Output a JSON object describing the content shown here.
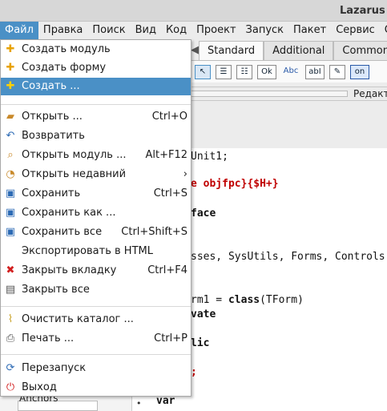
{
  "window": {
    "title": "Lazarus ID"
  },
  "menubar": [
    {
      "label": "Файл",
      "active": true
    },
    {
      "label": "Правка"
    },
    {
      "label": "Поиск"
    },
    {
      "label": "Вид"
    },
    {
      "label": "Код"
    },
    {
      "label": "Проект"
    },
    {
      "label": "Запуск"
    },
    {
      "label": "Пакет"
    },
    {
      "label": "Сервис"
    },
    {
      "label": "Ок"
    }
  ],
  "palette": {
    "tabs": [
      "Standard",
      "Additional",
      "Common"
    ],
    "arrow": "◀",
    "icons": [
      "arrow-pointer-icon",
      "main-menu-icon",
      "popup-menu-icon",
      "button-icon",
      "label-icon",
      "edit-icon",
      "memo-icon",
      "toggle-box-icon"
    ],
    "icon_text": {
      "button": "Ok",
      "label": "Abc",
      "edit": "abI",
      "toggle": "on"
    }
  },
  "editbar": {
    "label": "Редакт"
  },
  "editor": {
    "lines": [
      {
        "text": "Unit1;"
      },
      {
        "dir": "e objfpc}{$H+}"
      },
      {
        "text": "face",
        "bold": true
      },
      {
        "text": "sses, SysUtils, Forms, Controls"
      },
      {
        "text": "rm1 = ",
        "kw": "class",
        "rest": "(TForm)"
      },
      {
        "text": "vate",
        "bold": true
      },
      {
        "text": "lic",
        "bold": true
      },
      {
        "dir": ";"
      },
      {
        "text": "var",
        "bold": true
      }
    ],
    "anchors": "Anchors"
  },
  "file_menu": {
    "items": [
      {
        "label": "Создать модуль",
        "icon": "new-unit-icon",
        "glyph": "✚"
      },
      {
        "label": "Создать форму",
        "icon": "new-form-icon",
        "glyph": "✚"
      },
      {
        "label": "Создать ...",
        "icon": "new-icon",
        "glyph": "✚",
        "highlighted": true
      },
      {
        "label": "Открыть ...",
        "icon": "open-folder-icon",
        "glyph": "📂",
        "shortcut": "Ctrl+O"
      },
      {
        "label": "Возвратить",
        "icon": "revert-icon",
        "glyph": "↶"
      },
      {
        "label": "Открыть модуль ...",
        "icon": "open-unit-icon",
        "glyph": "🔍",
        "shortcut": "Alt+F12"
      },
      {
        "label": "Открыть недавний",
        "icon": "recent-icon",
        "glyph": "⟲",
        "submenu": "›"
      },
      {
        "label": "Сохранить",
        "icon": "save-icon",
        "glyph": "▣",
        "shortcut": "Ctrl+S"
      },
      {
        "label": "Сохранить как ...",
        "icon": "save-as-icon",
        "glyph": "▣"
      },
      {
        "label": "Сохранить все",
        "icon": "save-all-icon",
        "glyph": "▣",
        "shortcut": "Ctrl+Shift+S"
      },
      {
        "label": "Экспортировать в HTML"
      },
      {
        "label": "Закрыть вкладку",
        "icon": "close-tab-icon",
        "glyph": "✖",
        "shortcut": "Ctrl+F4"
      },
      {
        "label": "Закрыть все",
        "icon": "close-all-icon",
        "glyph": "▤"
      },
      {
        "label": "Очистить каталог ...",
        "icon": "broom-icon",
        "glyph": "🧹"
      },
      {
        "label": "Печать ...",
        "icon": "printer-icon",
        "glyph": "⎙",
        "shortcut": "Ctrl+P"
      },
      {
        "label": "Перезапуск",
        "icon": "restart-icon",
        "glyph": "⟳"
      },
      {
        "label": "Выход",
        "icon": "exit-icon",
        "glyph": "⏻"
      }
    ]
  }
}
